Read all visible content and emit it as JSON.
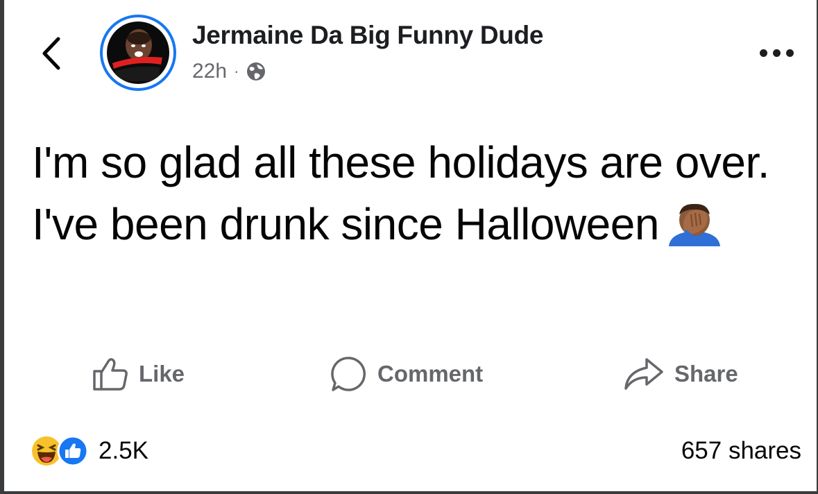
{
  "post": {
    "author_name": "Jermaine Da Big Funny Dude",
    "time": "22h",
    "separator": "·",
    "privacy_icon": "globe-icon",
    "text": "I'm so glad all these holidays are over. I've been drunk since Halloween",
    "emoji": "facepalm-emoji"
  },
  "actions": {
    "like_label": "Like",
    "comment_label": "Comment",
    "share_label": "Share"
  },
  "footer": {
    "reaction_icons": [
      "haha-reaction-icon",
      "like-reaction-icon"
    ],
    "reaction_count": "2.5K",
    "shares": "657 shares"
  },
  "colors": {
    "accent": "#1877f2",
    "text": "#050505",
    "secondary": "#65676b"
  }
}
